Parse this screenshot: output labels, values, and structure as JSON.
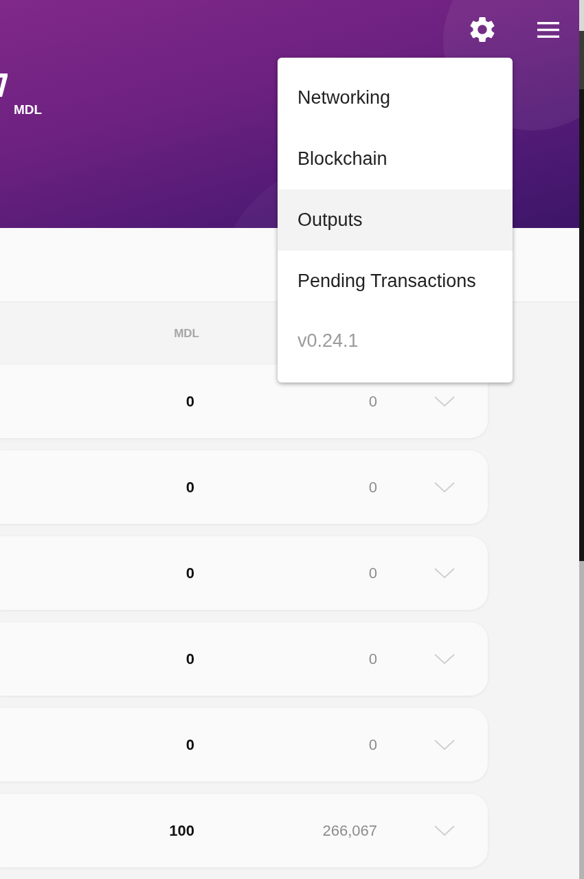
{
  "header": {
    "currency": "MDL"
  },
  "menu": {
    "items": [
      {
        "label": "Networking",
        "selected": false
      },
      {
        "label": "Blockchain",
        "selected": false
      },
      {
        "label": "Outputs",
        "selected": true
      },
      {
        "label": "Pending Transactions",
        "selected": false
      }
    ],
    "version": "v0.24.1"
  },
  "table": {
    "columns": [
      {
        "label": "MDL"
      }
    ],
    "rows": [
      {
        "cells": [
          "0",
          "0"
        ],
        "expanded": false
      },
      {
        "cells": [
          "0",
          "0"
        ],
        "expanded": false
      },
      {
        "cells": [
          "0",
          "0"
        ],
        "expanded": false
      },
      {
        "cells": [
          "0",
          "0"
        ],
        "expanded": false
      },
      {
        "cells": [
          "0",
          "0"
        ],
        "expanded": false
      },
      {
        "cells": [
          "100",
          "266,067"
        ],
        "expanded": false
      }
    ]
  }
}
